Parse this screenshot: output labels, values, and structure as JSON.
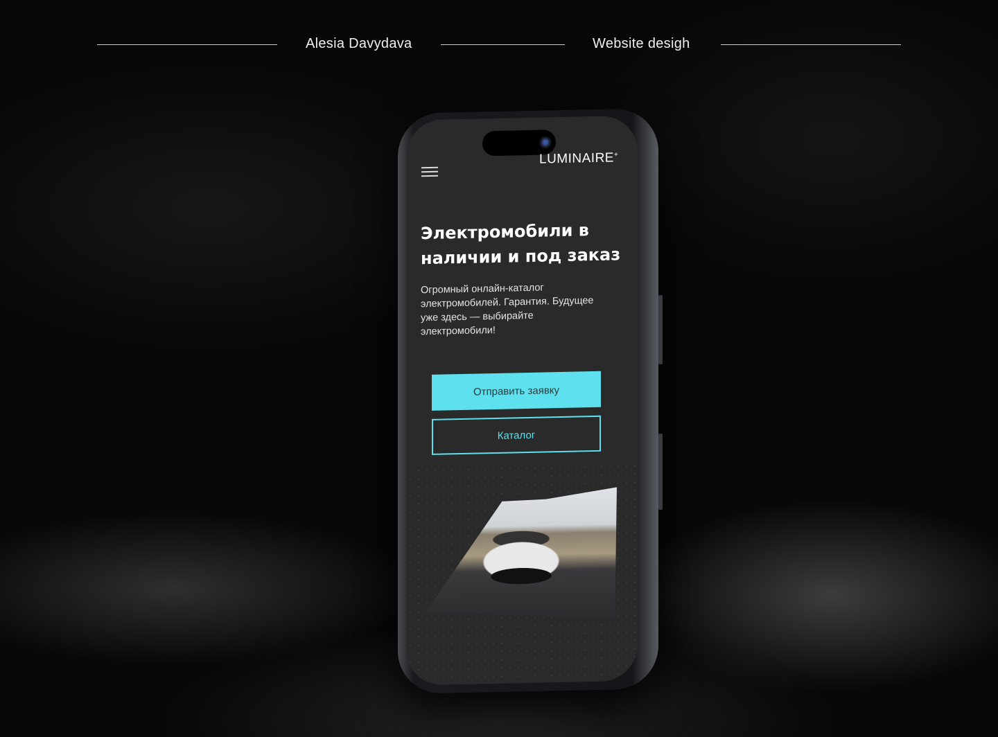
{
  "header": {
    "author": "Alesia Davydava",
    "subject": "Website desigh"
  },
  "site": {
    "logo": "LUMINAIRE",
    "logo_mark": "+",
    "hero_title": "Электромобили в наличии и под заказ",
    "hero_description": "Огромный онлайн-каталог электромобилей. Гарантия. Будущее уже здесь — выбирайте электромобили!",
    "primary_button": "Отправить заявку",
    "secondary_button": "Каталог",
    "accent_color": "#5ee1ee"
  }
}
